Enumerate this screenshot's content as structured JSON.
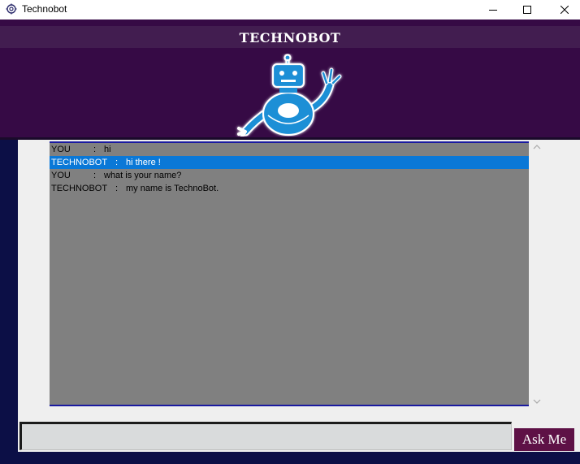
{
  "window": {
    "title": "Technobot",
    "icon": "app-gear-icon",
    "controls": [
      "minimize-icon",
      "maximize-icon",
      "close-icon"
    ]
  },
  "header": {
    "title": "TECHNOBOT",
    "logo": "robot-waving-icon",
    "background_color": "#360a45"
  },
  "chat": {
    "messages": [
      {
        "speaker": "YOU",
        "separator": ":",
        "text": "hi",
        "selected": false
      },
      {
        "speaker": "TECHNOBOT",
        "separator": ":",
        "text": "hi there !",
        "selected": true
      },
      {
        "speaker": "YOU",
        "separator": ":",
        "text": "what is your name?",
        "selected": false
      },
      {
        "speaker": "TECHNOBOT",
        "separator": ":",
        "text": "my name is TechnoBot.",
        "selected": false
      }
    ],
    "selection_color": "#0a78d7",
    "background_color": "#808080"
  },
  "input": {
    "value": "",
    "placeholder": ""
  },
  "ask_button": {
    "label": "Ask Me",
    "color": "#5e1146"
  }
}
